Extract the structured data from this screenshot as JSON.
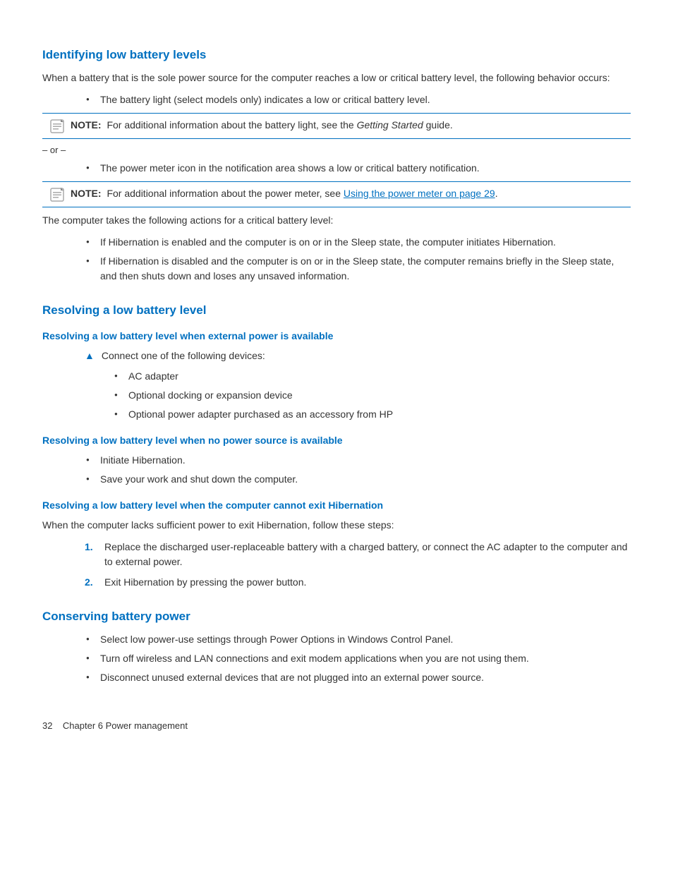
{
  "sections": {
    "identifying": {
      "title": "Identifying low battery levels",
      "intro": "When a battery that is the sole power source for the computer reaches a low or critical battery level, the following behavior occurs:",
      "bullet1": "The battery light (select models only) indicates a low or critical battery level.",
      "note1_label": "NOTE:",
      "note1_text": "For additional information about the battery light, see the ",
      "note1_italic": "Getting Started",
      "note1_text2": " guide.",
      "or_text": "– or –",
      "bullet2": "The power meter icon in the notification area shows a low or critical battery notification.",
      "note2_label": "NOTE:",
      "note2_text": "For additional information about the power meter, see ",
      "note2_link": "Using the power meter on page 29",
      "note2_text2": ".",
      "critical_intro": "The computer takes the following actions for a critical battery level:",
      "critical_bullet1": "If Hibernation is enabled and the computer is on or in the Sleep state, the computer initiates Hibernation.",
      "critical_bullet2": "If Hibernation is disabled and the computer is on or in the Sleep state, the computer remains briefly in the Sleep state, and then shuts down and loses any unsaved information."
    },
    "resolving": {
      "title": "Resolving a low battery level",
      "sub1": {
        "title": "Resolving a low battery level when external power is available",
        "warning_text": "Connect one of the following devices:",
        "bullets": [
          "AC adapter",
          "Optional docking or expansion device",
          "Optional power adapter purchased as an accessory from HP"
        ]
      },
      "sub2": {
        "title": "Resolving a low battery level when no power source is available",
        "bullets": [
          "Initiate Hibernation.",
          "Save your work and shut down the computer."
        ]
      },
      "sub3": {
        "title": "Resolving a low battery level when the computer cannot exit Hibernation",
        "intro": "When the computer lacks sufficient power to exit Hibernation, follow these steps:",
        "steps": [
          "Replace the discharged user-replaceable battery with a charged battery, or connect the AC adapter to the computer and to external power.",
          "Exit Hibernation by pressing the power button."
        ]
      }
    },
    "conserving": {
      "title": "Conserving battery power",
      "bullets": [
        "Select low power-use settings through Power Options in Windows Control Panel.",
        "Turn off wireless and LAN connections and exit modem applications when you are not using them.",
        "Disconnect unused external devices that are not plugged into an external power source."
      ]
    }
  },
  "footer": {
    "page_num": "32",
    "chapter": "Chapter 6  Power management"
  }
}
